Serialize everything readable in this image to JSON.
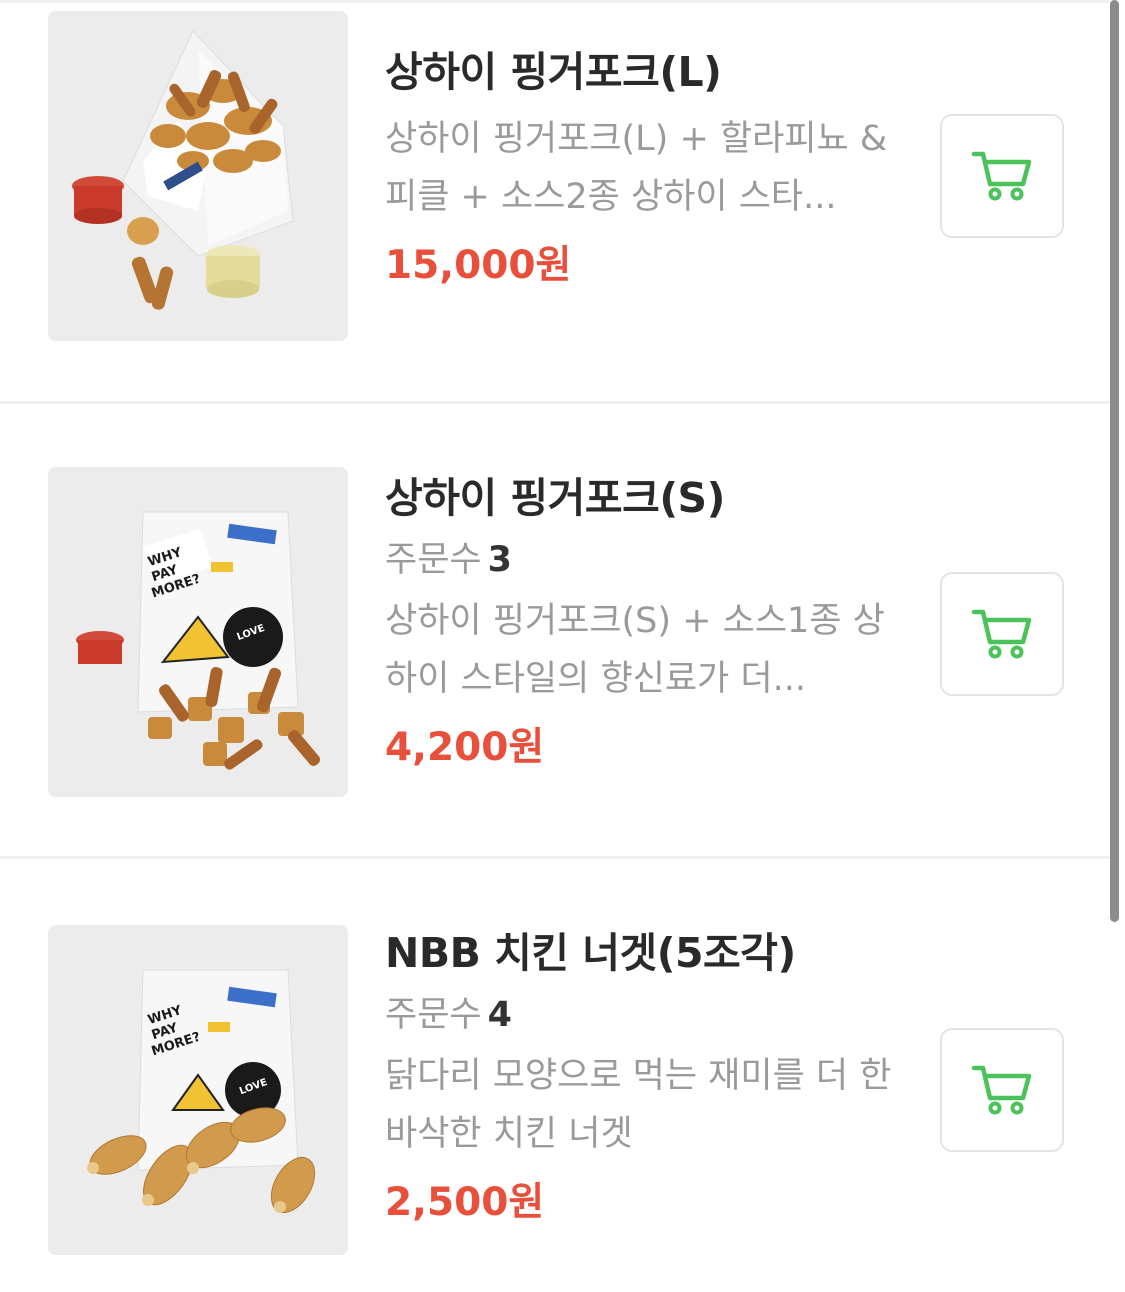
{
  "accent_price_color": "#e8503c",
  "cart_icon_color": "#4cc35a",
  "items": [
    {
      "name": "상하이 핑거포크(L)",
      "orders_label": "",
      "orders_count": "",
      "description": "상하이 핑거포크(L) + 할라피뇨 &피클 + 소스2종 상하이 스타...",
      "price": "15,000원",
      "image_icon": "fried-pork-box-image",
      "cart_icon": "cart-icon"
    },
    {
      "name": "상하이 핑거포크(S)",
      "orders_label": "주문수",
      "orders_count": "3",
      "description": "상하이 핑거포크(S) + 소스1종 상하이 스타일의 향신료가 더...",
      "price": "4,200원",
      "image_icon": "fried-pork-bag-image",
      "cart_icon": "cart-icon"
    },
    {
      "name": "NBB 치킨 너겟(5조각)",
      "orders_label": "주문수",
      "orders_count": "4",
      "description": "닭다리 모양으로 먹는 재미를 더 한 바삭한 치킨 너겟",
      "price": "2,500원",
      "image_icon": "chicken-nugget-bag-image",
      "cart_icon": "cart-icon"
    }
  ]
}
